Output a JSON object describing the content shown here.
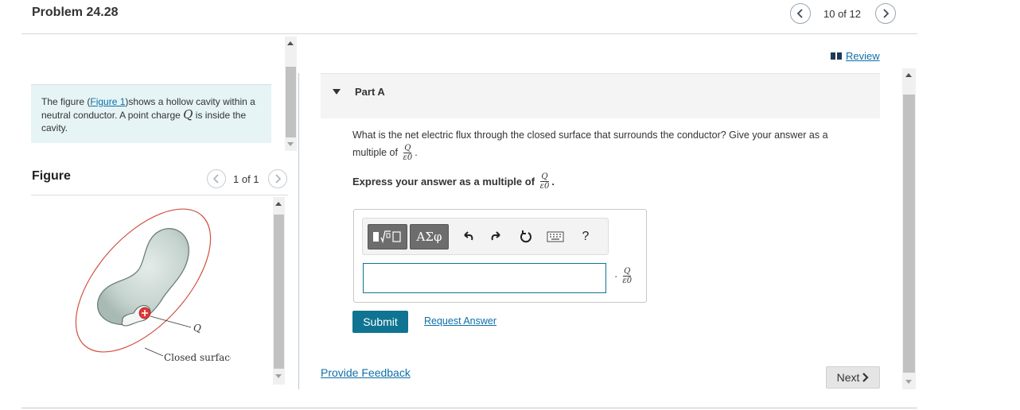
{
  "header": {
    "title": "Problem 24.28",
    "pager_text": "10 of 12"
  },
  "intro": {
    "text_before_link": "The figure (",
    "link": "Figure 1",
    "text_after_link": ")shows a hollow cavity within a neutral conductor. A point charge ",
    "symbol": "Q",
    "text_end": " is inside the cavity."
  },
  "figure_panel": {
    "label": "Figure",
    "pager_text": "1 of 1",
    "labels": {
      "charge": "Q",
      "surface": "Closed surface"
    }
  },
  "review": {
    "label": "Review"
  },
  "part_a": {
    "title": "Part A",
    "question": "What is the net electric flux through the closed surface that surrounds the conductor? Give your answer as a",
    "question_line2": "multiple of",
    "frac_num": "Q",
    "frac_den": "ε0",
    "period": ".",
    "express_prefix": "Express your answer as a multiple of",
    "toolbar": {
      "matrix_button": "",
      "greek_button": "ΑΣφ",
      "help": "?"
    },
    "answer_value": "",
    "unit_prefix": "·",
    "submit": "Submit",
    "request_answer": "Request Answer"
  },
  "footer": {
    "provide_feedback": "Provide Feedback",
    "next": "Next"
  },
  "colors": {
    "accent": "#0f7491",
    "link": "#0e6fa8",
    "intro_bg": "#e6f4f6",
    "surface_line": "#d05040",
    "charge": "#e03838",
    "conductor": "#c8d6d2"
  },
  "icons": [
    "chevron-left-icon",
    "chevron-right-icon",
    "book-icon",
    "caret-down-icon",
    "undo-icon",
    "redo-icon",
    "reset-icon",
    "keyboard-icon",
    "help-icon",
    "chevron-right-next-icon",
    "scroll-up-arrow-icon",
    "scroll-down-arrow-icon"
  ]
}
